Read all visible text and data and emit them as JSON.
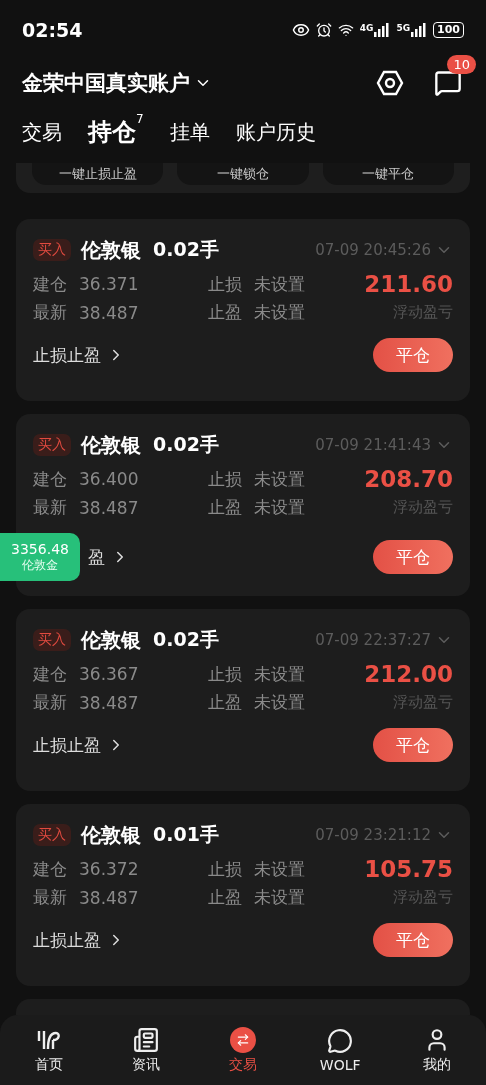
{
  "status_bar": {
    "time": "02:54",
    "network_1": "4G",
    "network_2": "5G",
    "battery": "100"
  },
  "header": {
    "account": "金荣中国真实账户",
    "message_count": "10"
  },
  "tabs": [
    {
      "label": "交易",
      "selected": false
    },
    {
      "label": "持仓",
      "selected": true,
      "count": "7"
    },
    {
      "label": "挂单",
      "selected": false
    },
    {
      "label": "账户历史",
      "selected": false
    }
  ],
  "quick_actions": [
    "一键止损止盈",
    "一键锁仓",
    "一键平仓"
  ],
  "positions": [
    {
      "side": "买入",
      "symbol": "伦敦银",
      "lots": "0.02手",
      "time": "07-09 20:45:26",
      "open_label": "建仓",
      "open_price": "36.371",
      "latest_label": "最新",
      "latest_price": "38.487",
      "sl_label": "止损",
      "sl_value": "未设置",
      "tp_label": "止盈",
      "tp_value": "未设置",
      "profit": "211.60",
      "profit_label": "浮动盈亏",
      "link": "止损止盈",
      "close": "平仓"
    },
    {
      "side": "买入",
      "symbol": "伦敦银",
      "lots": "0.02手",
      "time": "07-09 21:41:43",
      "open_label": "建仓",
      "open_price": "36.400",
      "latest_label": "最新",
      "latest_price": "38.487",
      "sl_label": "止损",
      "sl_value": "未设置",
      "tp_label": "止盈",
      "tp_value": "未设置",
      "profit": "208.70",
      "profit_label": "浮动盈亏",
      "link": "盈",
      "close": "平仓",
      "quote_badge": {
        "price": "3356.48",
        "name": "伦敦金"
      }
    },
    {
      "side": "买入",
      "symbol": "伦敦银",
      "lots": "0.02手",
      "time": "07-09 22:37:27",
      "open_label": "建仓",
      "open_price": "36.367",
      "latest_label": "最新",
      "latest_price": "38.487",
      "sl_label": "止损",
      "sl_value": "未设置",
      "tp_label": "止盈",
      "tp_value": "未设置",
      "profit": "212.00",
      "profit_label": "浮动盈亏",
      "link": "止损止盈",
      "close": "平仓"
    },
    {
      "side": "买入",
      "symbol": "伦敦银",
      "lots": "0.01手",
      "time": "07-09 23:21:12",
      "open_label": "建仓",
      "open_price": "36.372",
      "latest_label": "最新",
      "latest_price": "38.487",
      "sl_label": "止损",
      "sl_value": "未设置",
      "tp_label": "止盈",
      "tp_value": "未设置",
      "profit": "105.75",
      "profit_label": "浮动盈亏",
      "link": "止损止盈",
      "close": "平仓"
    }
  ],
  "bottom_nav": [
    {
      "label": "首页",
      "selected": false
    },
    {
      "label": "资讯",
      "selected": false
    },
    {
      "label": "交易",
      "selected": true
    },
    {
      "label": "WOLF",
      "selected": false
    },
    {
      "label": "我的",
      "selected": false
    }
  ]
}
